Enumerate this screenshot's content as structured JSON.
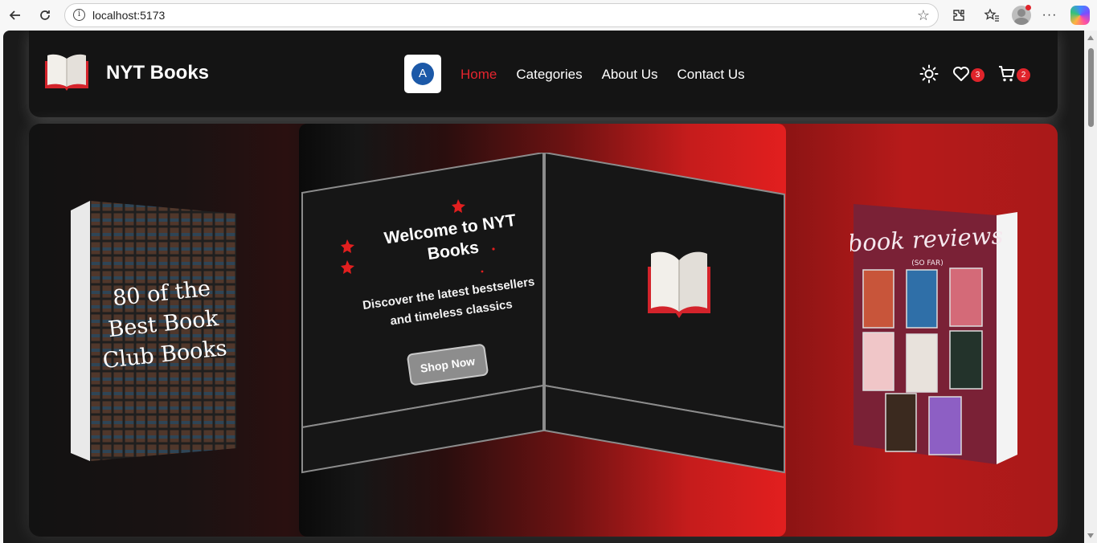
{
  "browser": {
    "url": "localhost:5173"
  },
  "header": {
    "brand": "NYT Books",
    "avatar_initial": "A",
    "nav": [
      {
        "label": "Home",
        "active": true
      },
      {
        "label": "Categories",
        "active": false
      },
      {
        "label": "About Us",
        "active": false
      },
      {
        "label": "Contact Us",
        "active": false
      }
    ],
    "wishlist_count": "3",
    "cart_count": "2",
    "accent_color": "#e4252e"
  },
  "hero": {
    "title": "Welcome to NYT Books",
    "subtitle": "Discover the latest bestsellers and timeless classics",
    "cta_label": "Shop Now",
    "left_book": {
      "cover_text": "80 of the Best Book Club Books"
    },
    "right_book": {
      "cover_title": "book reviews",
      "cover_subtitle": "(SO FAR)"
    }
  },
  "icons": [
    "back-icon",
    "reload-icon",
    "info-icon",
    "favorite-star-icon",
    "extensions-icon",
    "favorites-icon",
    "profile-avatar",
    "more-icon",
    "copilot-icon",
    "sun-icon",
    "heart-icon",
    "cart-icon",
    "open-book-icon"
  ]
}
